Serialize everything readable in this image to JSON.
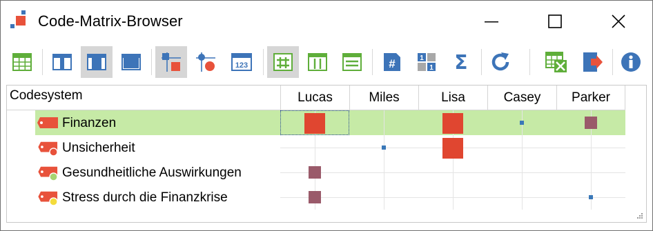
{
  "window": {
    "title": "Code-Matrix-Browser"
  },
  "toolbar": {
    "buttons": [
      {
        "name": "table-view-icon"
      },
      {
        "name": "column-layout-1-icon"
      },
      {
        "name": "column-layout-2-icon"
      },
      {
        "name": "column-layout-3-icon"
      },
      {
        "name": "symbol-squares-icon"
      },
      {
        "name": "symbol-circles-icon"
      },
      {
        "name": "numbers-icon",
        "text": "123"
      },
      {
        "name": "grid-lines-icon"
      },
      {
        "name": "vertical-lines-icon"
      },
      {
        "name": "horizontal-lines-icon"
      },
      {
        "name": "hash-icon",
        "text": "#"
      },
      {
        "name": "binary-icon",
        "text": "1"
      },
      {
        "name": "sigma-icon",
        "text": "Σ"
      },
      {
        "name": "refresh-icon"
      },
      {
        "name": "excel-export-icon"
      },
      {
        "name": "export-icon"
      },
      {
        "name": "info-icon",
        "text": "i"
      }
    ]
  },
  "matrix": {
    "header_codesystem": "Codesystem",
    "columns": [
      "Lucas",
      "Miles",
      "Lisa",
      "Casey",
      "Parker"
    ],
    "rows": [
      {
        "label": "Finanzen",
        "tag_color": "#e8523b",
        "dot_color": null,
        "cells": [
          "large-red",
          null,
          "large-red",
          "tiny-blue",
          "medium-mauve"
        ]
      },
      {
        "label": "Unsicherheit",
        "tag_color": "#e8523b",
        "dot_color": "#e8523b",
        "cells": [
          null,
          "tiny-blue",
          "large-red",
          null,
          null
        ]
      },
      {
        "label": "Gesundheitliche Auswirkungen",
        "tag_color": "#e8523b",
        "dot_color": "#a6d472",
        "cells": [
          "medium-mauve",
          null,
          null,
          null,
          null
        ]
      },
      {
        "label": "Stress durch die Finanzkrise",
        "tag_color": "#e8523b",
        "dot_color": "#f4dc3c",
        "cells": [
          "medium-mauve",
          null,
          null,
          null,
          "tiny-blue"
        ]
      }
    ]
  },
  "colors": {
    "selected_row": "#c6eaa6",
    "large_square": "#e04630",
    "medium_square": "#9a5a6a",
    "tiny_square": "#3a78b8",
    "toolbar_blue": "#3d74b8",
    "toolbar_green": "#5fae3a"
  }
}
